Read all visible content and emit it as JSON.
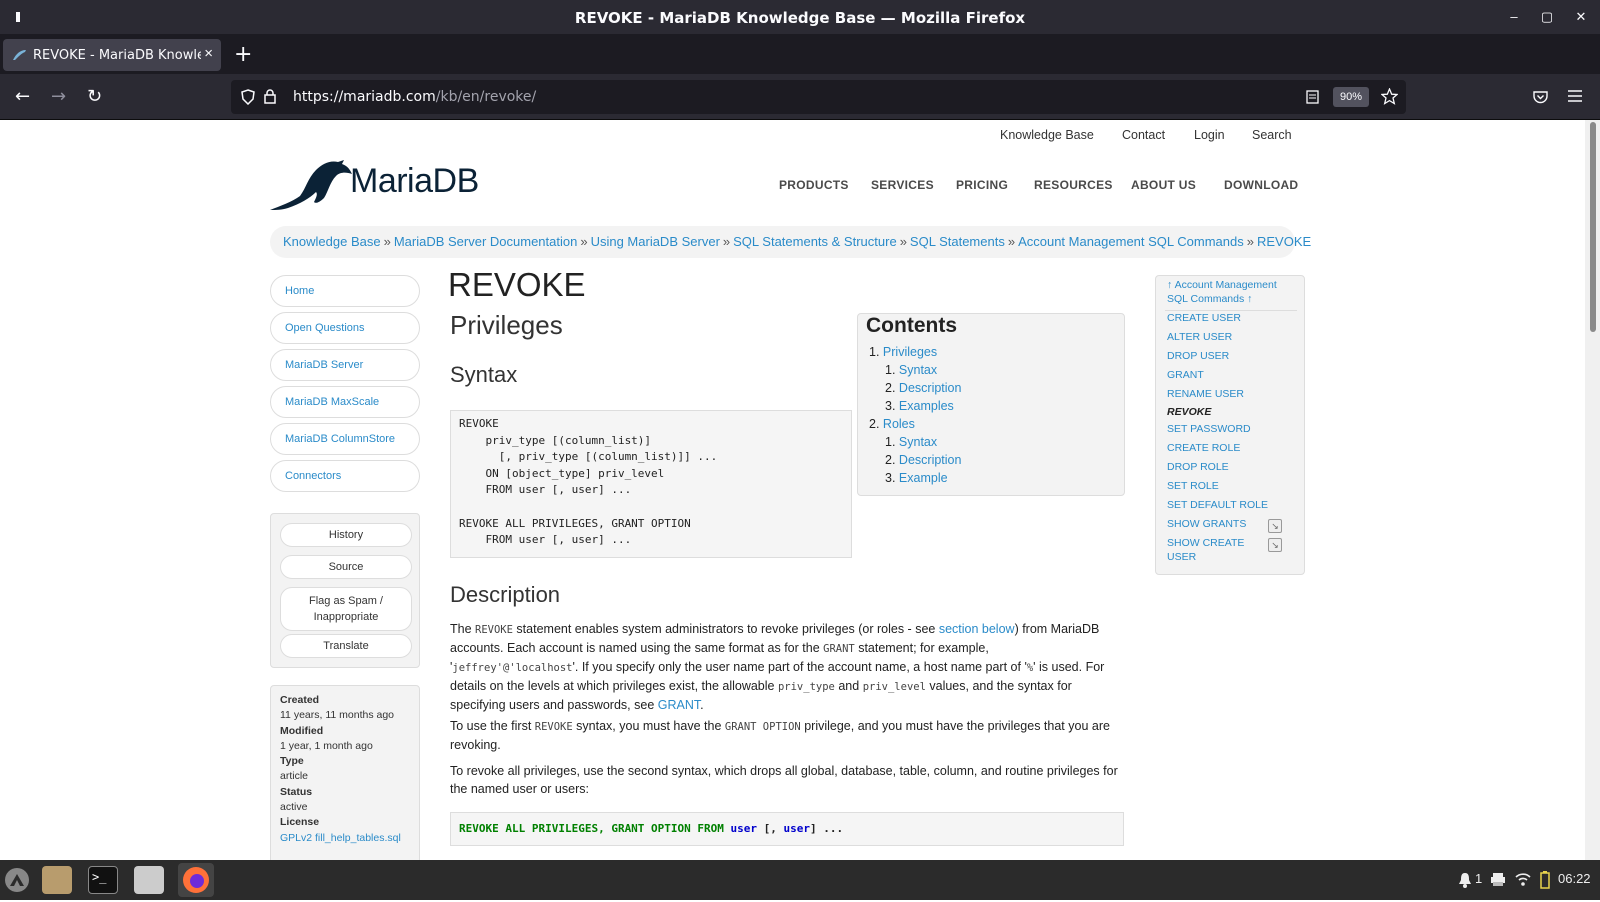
{
  "window": {
    "title": "REVOKE - MariaDB Knowledge Base — Mozilla Firefox",
    "minimize": "–",
    "maximize": "▢",
    "close": "✕"
  },
  "tab": {
    "title": "REVOKE - MariaDB Knowledge Base",
    "close": "×",
    "new_tab": "+"
  },
  "nav": {
    "url_host": "https://mariadb.com",
    "url_path": "/kb/en/revoke/",
    "zoom": "90%",
    "back": "←",
    "forward": "→",
    "reload": "↻"
  },
  "site": {
    "top_links": [
      "Knowledge Base",
      "Contact",
      "Login",
      "Search"
    ],
    "logo_text": "MariaDB",
    "main_nav": [
      "PRODUCTS",
      "SERVICES",
      "PRICING",
      "RESOURCES",
      "ABOUT US",
      "DOWNLOAD"
    ]
  },
  "breadcrumb": [
    "Knowledge Base",
    "MariaDB Server Documentation",
    "Using MariaDB Server",
    "SQL Statements & Structure",
    "SQL Statements",
    "Account Management SQL Commands",
    "REVOKE"
  ],
  "breadcrumb_sep": "»",
  "sidebar": {
    "nav": [
      "Home",
      "Open Questions",
      "MariaDB Server",
      "MariaDB MaxScale",
      "MariaDB ColumnStore",
      "Connectors"
    ],
    "tools": [
      "History",
      "Source",
      "Flag as Spam / Inappropriate",
      "Translate"
    ],
    "meta": {
      "created_label": "Created",
      "created": "11 years, 11 months ago",
      "modified_label": "Modified",
      "modified": "1 year, 1 month ago",
      "type_label": "Type",
      "type": "article",
      "status_label": "Status",
      "status": "active",
      "license_label": "License",
      "license": "GPLv2 fill_help_tables.sql"
    }
  },
  "content": {
    "title": "REVOKE",
    "h_privileges": "Privileges",
    "h_syntax": "Syntax",
    "syntax_code": "REVOKE\n    priv_type [(column_list)]\n      [, priv_type [(column_list)]] ...\n    ON [object_type] priv_level\n    FROM user [, user] ...\n\nREVOKE ALL PRIVILEGES, GRANT OPTION\n    FROM user [, user] ...",
    "h_description": "Description",
    "p1": {
      "a": "The ",
      "code1": "REVOKE",
      "b": " statement enables system administrators to revoke privileges (or roles - see ",
      "link1": "section below",
      "c": ") from MariaDB accounts. Each account is named using the same format as for the ",
      "code2": "GRANT",
      "d": " statement; for example, '",
      "code3": "jeffrey'@'localhost",
      "e": "'. If you specify only the user name part of the account name, a host name part of '",
      "code4": "%",
      "f": "' is used. For details on the levels at which privileges exist, the allowable ",
      "code5": "priv_type",
      "g": " and ",
      "code6": "priv_level",
      "h": " values, and the syntax for specifying users and passwords, see ",
      "link2": "GRANT",
      "i": "."
    },
    "p2": {
      "a": "To use the first ",
      "code1": "REVOKE",
      "b": " syntax, you must have the ",
      "code2": "GRANT OPTION",
      "c": " privilege, and you must have the privileges that you are revoking."
    },
    "p3": "To revoke all privileges, use the second syntax, which drops all global, database, table, column, and routine privileges for the named user or users:",
    "code2_kw1": "REVOKE ALL PRIVILEGES, GRANT OPTION FROM",
    "code2_kw2": "user",
    "code2_rest1": " [, ",
    "code2_kw3": "user",
    "code2_rest2": "] ..."
  },
  "contents": {
    "title": "Contents",
    "items": [
      {
        "num": "1.",
        "label": "Privileges"
      },
      {
        "num": "1.",
        "label": "Syntax"
      },
      {
        "num": "2.",
        "label": "Description"
      },
      {
        "num": "3.",
        "label": "Examples"
      },
      {
        "num": "2.",
        "label": "Roles"
      },
      {
        "num": "1.",
        "label": "Syntax"
      },
      {
        "num": "2.",
        "label": "Description"
      },
      {
        "num": "3.",
        "label": "Example"
      }
    ]
  },
  "right_sidebar": {
    "up_link": "↑ Account Management SQL Commands ↑",
    "links": [
      "CREATE USER",
      "ALTER USER",
      "DROP USER",
      "GRANT",
      "RENAME USER",
      "REVOKE",
      "SET PASSWORD",
      "CREATE ROLE",
      "DROP ROLE",
      "SET ROLE",
      "SET DEFAULT ROLE",
      "SHOW GRANTS",
      "SHOW CREATE USER"
    ],
    "ext_icon": "↘"
  },
  "taskbar": {
    "notif_count": "1",
    "clock": "06:22"
  }
}
